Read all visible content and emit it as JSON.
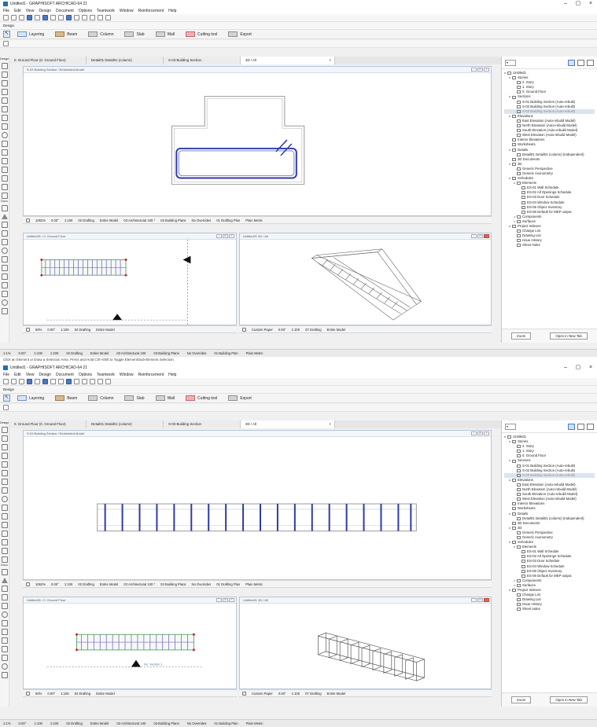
{
  "colors": {
    "accent": "#1f6fb2",
    "selection": "#dbe5f1",
    "rebar": "#2e3ba8"
  },
  "titlebar": {
    "title": "Untitled1 - GRAPHISOFT ARCHICAD-64 21"
  },
  "menu": [
    "File",
    "Edit",
    "View",
    "Design",
    "Document",
    "Options",
    "Teamwork",
    "Window",
    "Reinforcement",
    "Help"
  ],
  "design_label": "Design",
  "infobox_tools": [
    "Layering",
    "Beam",
    "Column",
    "Slab",
    "Wall",
    "Cutting tool",
    "Export"
  ],
  "tabs": [
    {
      "label": "0. Ground Floor (0. Ground Floor)"
    },
    {
      "label": "Detail01 Detail01 (column)"
    },
    {
      "label": "S-03 Building Section"
    },
    {
      "label": "3D / All"
    }
  ],
  "toolbox_label": "Design",
  "toolbox_label2": "Docu",
  "panes": {
    "section_title": "S-03 Building Section / Embedded Model",
    "plan_title": "Untitled01 / 0. Ground Floor",
    "threed_title": "Untitled01 3D / All",
    "marker_label": "No. Section 1"
  },
  "viewbar_top": [
    "1062%",
    "0.00°",
    "1:100",
    "02 Drafting",
    "Entire Model",
    "03 Architectural 100 *",
    "03 Building Plans",
    "No Overrides",
    "01 Drafting Plan",
    "Plain Metric"
  ],
  "viewbar_bottom_left": [
    "50%",
    "0.00°",
    "1:100",
    "02 Drafting",
    "Entire Model"
  ],
  "viewbar_bottom_right": [
    "Custom Paper",
    "0.00°",
    "1:100",
    "07 Drafting",
    "Entire Model"
  ],
  "statusbar": [
    "1:1%",
    "0.00°",
    "1:100",
    "1:100",
    "02 Drafting",
    "Entire Model",
    "03 Architectural 100",
    "03 Building Plans",
    "No Overrides",
    "01 Building Plan",
    "Plain Metric"
  ],
  "hint": "Click an Element or Draw a Selection Area. Press and Hold Ctrl+Shift to Toggle Element/Sub-Element Selection.",
  "navigator": {
    "dropdown": "",
    "items": [
      {
        "label": "Untitled1",
        "level": 0,
        "caret": "v"
      },
      {
        "label": "Stories",
        "level": 1,
        "caret": "v"
      },
      {
        "label": "2. Story",
        "level": 2,
        "caret": ""
      },
      {
        "label": "1. Story",
        "level": 2,
        "caret": ""
      },
      {
        "label": "0. Ground Floor",
        "level": 2,
        "caret": ""
      },
      {
        "label": "Sections",
        "level": 1,
        "caret": "v"
      },
      {
        "label": "S-01 Building Section (Auto-rebuilt)",
        "level": 2,
        "caret": ""
      },
      {
        "label": "S-02 Building Section (Auto-rebuilt)",
        "level": 2,
        "caret": ""
      },
      {
        "label": "S-03 Building Section (Auto-rebuilt)",
        "level": 2,
        "caret": "",
        "selected": true
      },
      {
        "label": "Elevations",
        "level": 1,
        "caret": "v"
      },
      {
        "label": "East Elevation (Auto-rebuild Model)",
        "level": 2,
        "caret": ""
      },
      {
        "label": "North Elevation (Auto-rebuild Model)",
        "level": 2,
        "caret": ""
      },
      {
        "label": "South Elevation (Auto-rebuild Model)",
        "level": 2,
        "caret": ""
      },
      {
        "label": "West Elevation (Auto-rebuild Model)",
        "level": 2,
        "caret": ""
      },
      {
        "label": "Interior Elevations",
        "level": 1,
        "caret": ""
      },
      {
        "label": "Worksheets",
        "level": 1,
        "caret": ""
      },
      {
        "label": "Details",
        "level": 1,
        "caret": "v"
      },
      {
        "label": "Detail01 Detail01 (column) (Independent)",
        "level": 2,
        "caret": ""
      },
      {
        "label": "3D Documents",
        "level": 1,
        "caret": ""
      },
      {
        "label": "3D",
        "level": 1,
        "caret": "v"
      },
      {
        "label": "Generic Perspective",
        "level": 2,
        "caret": ""
      },
      {
        "label": "Generic Axonometry",
        "level": 2,
        "caret": ""
      },
      {
        "label": "Schedules",
        "level": 1,
        "caret": "v"
      },
      {
        "label": "Elements",
        "level": 2,
        "caret": "v"
      },
      {
        "label": "ES-01 Wall Schedule",
        "level": 3,
        "caret": ""
      },
      {
        "label": "ES-02 All Openings Schedule",
        "level": 3,
        "caret": ""
      },
      {
        "label": "ES-03 Door Schedule",
        "level": 3,
        "caret": ""
      },
      {
        "label": "ES-04 Window Schedule",
        "level": 3,
        "caret": ""
      },
      {
        "label": "ES-05 Object Inventory",
        "level": 3,
        "caret": ""
      },
      {
        "label": "ES-06 Default for MEP output",
        "level": 3,
        "caret": ""
      },
      {
        "label": "Components",
        "level": 2,
        "caret": ">"
      },
      {
        "label": "Surfaces",
        "level": 2,
        "caret": ">"
      },
      {
        "label": "Project Indexes",
        "level": 1,
        "caret": "v"
      },
      {
        "label": "Change List",
        "level": 2,
        "caret": ""
      },
      {
        "label": "Drawing List",
        "level": 2,
        "caret": ""
      },
      {
        "label": "Issue History",
        "level": 2,
        "caret": ""
      },
      {
        "label": "Sheet Index",
        "level": 2,
        "caret": ""
      }
    ],
    "foot_left": "Zoom",
    "foot_right": "Open in New Tab"
  }
}
